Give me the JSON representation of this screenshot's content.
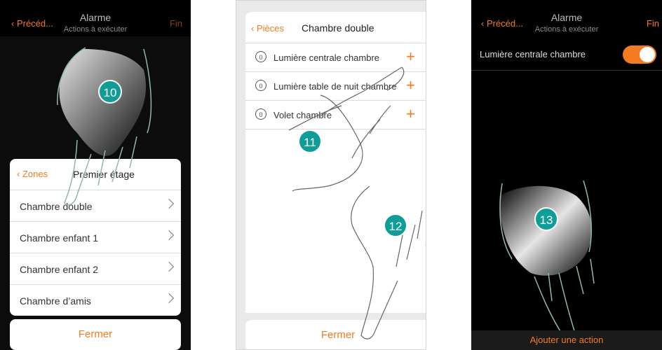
{
  "screen1": {
    "back_label": "Précéd...",
    "title": "Alarme",
    "subtitle": "Actions à exécuter",
    "fin_label": "Fin",
    "sheet_back": "Zones",
    "sheet_title": "Premier étage",
    "rooms": [
      "Chambre double",
      "Chambre enfant 1",
      "Chambre enfant 2",
      "Chambre d’amis"
    ],
    "close_label": "Fermer",
    "step": "10"
  },
  "screen2": {
    "back_label": "Pièces",
    "title": "Chambre double",
    "devices": [
      {
        "label": "Lumière centrale chambre",
        "count": "0"
      },
      {
        "label": "Lumière table de nuit chambre",
        "count": "0"
      },
      {
        "label": "Volet chambre",
        "count": "0"
      }
    ],
    "close_label": "Fermer",
    "step_a": "11",
    "step_b": "12"
  },
  "screen3": {
    "back_label": "Précéd...",
    "title": "Alarme",
    "subtitle": "Actions à exécuter",
    "fin_label": "Fin",
    "row_label": "Lumière centrale chambre",
    "toggle_on": true,
    "add_action_label": "Ajouter une action",
    "step": "13"
  },
  "colors": {
    "accent": "#f47b20",
    "badge": "#0f9e97"
  }
}
